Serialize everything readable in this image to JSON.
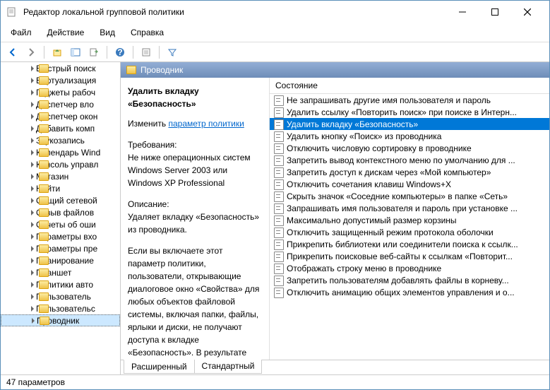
{
  "window": {
    "title": "Редактор локальной групповой политики"
  },
  "menubar": {
    "file": "Файл",
    "action": "Действие",
    "view": "Вид",
    "help": "Справка"
  },
  "sidebar": {
    "items": [
      {
        "label": "Быстрый поиск"
      },
      {
        "label": "Виртуализация"
      },
      {
        "label": "Гаджеты рабоч"
      },
      {
        "label": "Диспетчер вло"
      },
      {
        "label": "Диспетчер окон"
      },
      {
        "label": "Добавить комп"
      },
      {
        "label": "Звукозапись"
      },
      {
        "label": "Календарь Wind"
      },
      {
        "label": "Консоль управл"
      },
      {
        "label": "Магазин"
      },
      {
        "label": "Найти"
      },
      {
        "label": "Общий сетевой"
      },
      {
        "label": "Отзыв файлов"
      },
      {
        "label": "Отчеты об оши"
      },
      {
        "label": "Параметры вхо"
      },
      {
        "label": "Параметры пре"
      },
      {
        "label": "Планирование"
      },
      {
        "label": "Планшет"
      },
      {
        "label": "Политики авто"
      },
      {
        "label": "Пользователь"
      },
      {
        "label": "Пользовательс"
      },
      {
        "label": "Проводник"
      }
    ],
    "selectedIndex": 21
  },
  "content": {
    "header": "Проводник",
    "desc": {
      "title": "Удалить вкладку «Безопасность»",
      "edit_label": "Изменить",
      "edit_link": "параметр политики",
      "req_label": "Требования:",
      "req_text": "Не ниже операционных систем Windows Server 2003 или Windows XP Professional",
      "desc_label": "Описание:",
      "desc_text": "Удаляет вкладку «Безопасность» из проводника.",
      "body": "Если вы включаете этот параметр политики, пользователи, открывающие диалоговое окно «Свойства» для любых объектов файловой системы, включая папки, файлы, ярлыки и диски, не получают доступа к вкладке «Безопасность». В результате пользователи не могут изменять параметры"
    },
    "list": {
      "column": "Состояние",
      "items": [
        "Не запрашивать другие имя пользователя и пароль",
        "Удалить ссылку «Повторить поиск» при поиске в Интерн...",
        "Удалить вкладку «Безопасность»",
        "Удалить кнопку «Поиск» из проводника",
        "Отключить числовую сортировку в проводнике",
        "Запретить вывод контекстного меню по умолчанию для ...",
        "Запретить доступ к дискам через «Мой компьютер»",
        "Отключить сочетания клавиш Windows+X",
        "Скрыть значок «Соседние компьютеры» в папке «Сеть»",
        "Запрашивать имя пользователя и пароль при установке ...",
        "Максимально допустимый размер корзины",
        "Отключить защищенный режим протокола оболочки",
        "Прикрепить библиотеки или соединители поиска к ссылк...",
        "Прикрепить поисковые веб-сайты к ссылкам «Повторит...",
        "Отображать строку меню в проводнике",
        "Запретить пользователям добавлять файлы в корневу...",
        "Отключить анимацию общих элементов управления и о..."
      ],
      "selectedIndex": 2
    },
    "tabs": {
      "extended": "Расширенный",
      "standard": "Стандартный"
    }
  },
  "statusbar": {
    "text": "47 параметров"
  }
}
